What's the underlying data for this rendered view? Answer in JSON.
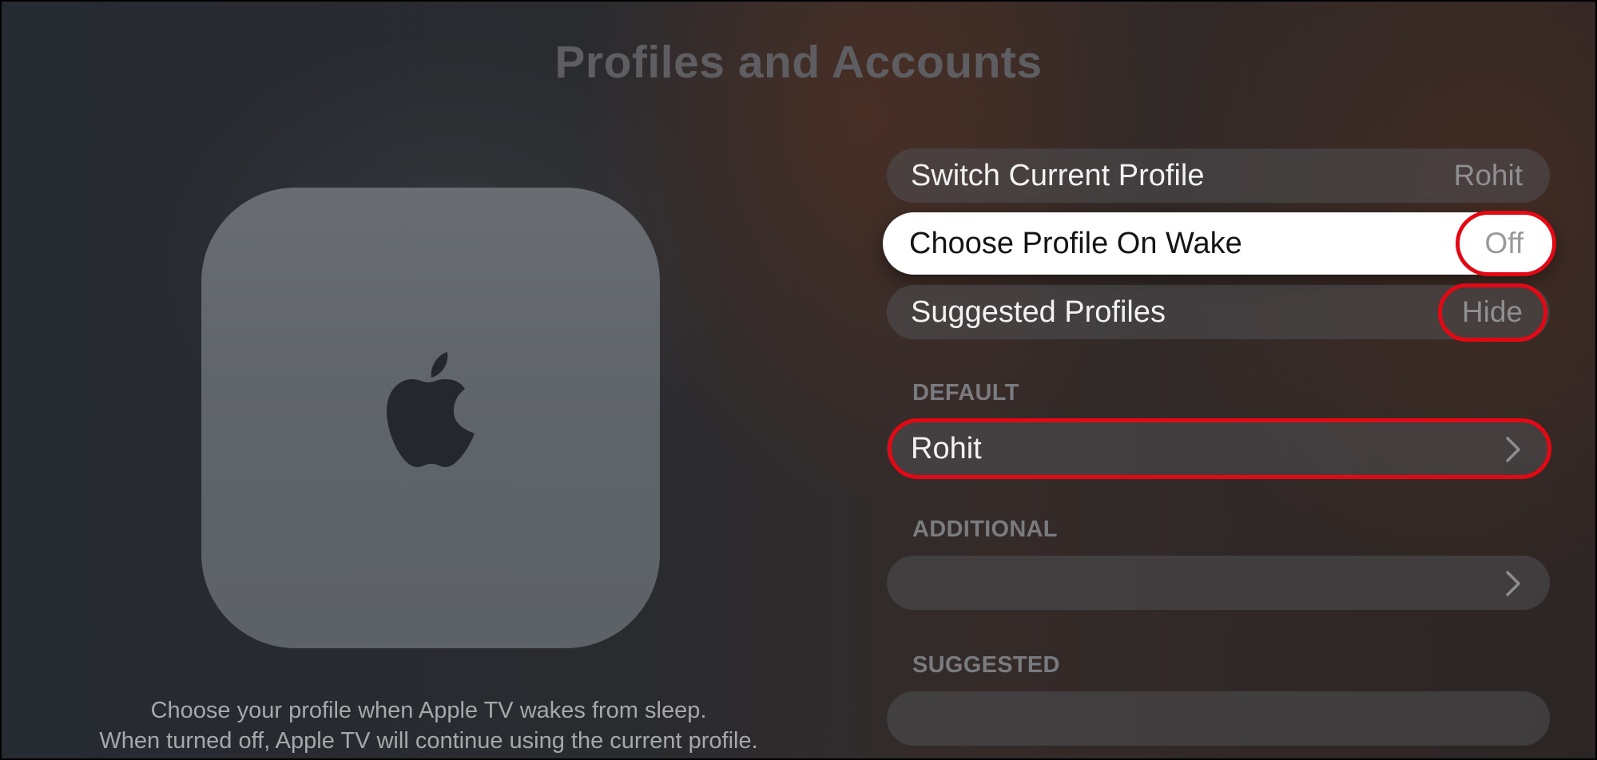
{
  "header": {
    "title": "Profiles and Accounts"
  },
  "preview": {
    "device_icon": "apple-tv-device",
    "logo_icon": "apple-logo-icon",
    "description_line_1": "Choose your profile when Apple TV wakes from sleep.",
    "description_line_2": "When turned off, Apple TV will continue using the current profile."
  },
  "settings": {
    "rows": [
      {
        "label": "Switch Current Profile",
        "value": "Rohit"
      },
      {
        "label": "Choose Profile On Wake",
        "value": "Off",
        "focused": true
      },
      {
        "label": "Suggested Profiles",
        "value": "Hide"
      }
    ]
  },
  "sections": {
    "default": {
      "header": "DEFAULT",
      "item_label": "Rohit",
      "chevron_icon": "chevron-right-icon"
    },
    "additional": {
      "header": "ADDITIONAL",
      "item_label": "",
      "chevron_icon": "chevron-right-icon"
    },
    "suggested": {
      "header": "SUGGESTED",
      "item_label": ""
    }
  },
  "annotations": {
    "highlight_color": "#e40814"
  },
  "colors": {
    "focused_row": "#ffffff",
    "row_background": "#505054",
    "title_text": "#5e5e62",
    "device_body": "#62676c"
  }
}
